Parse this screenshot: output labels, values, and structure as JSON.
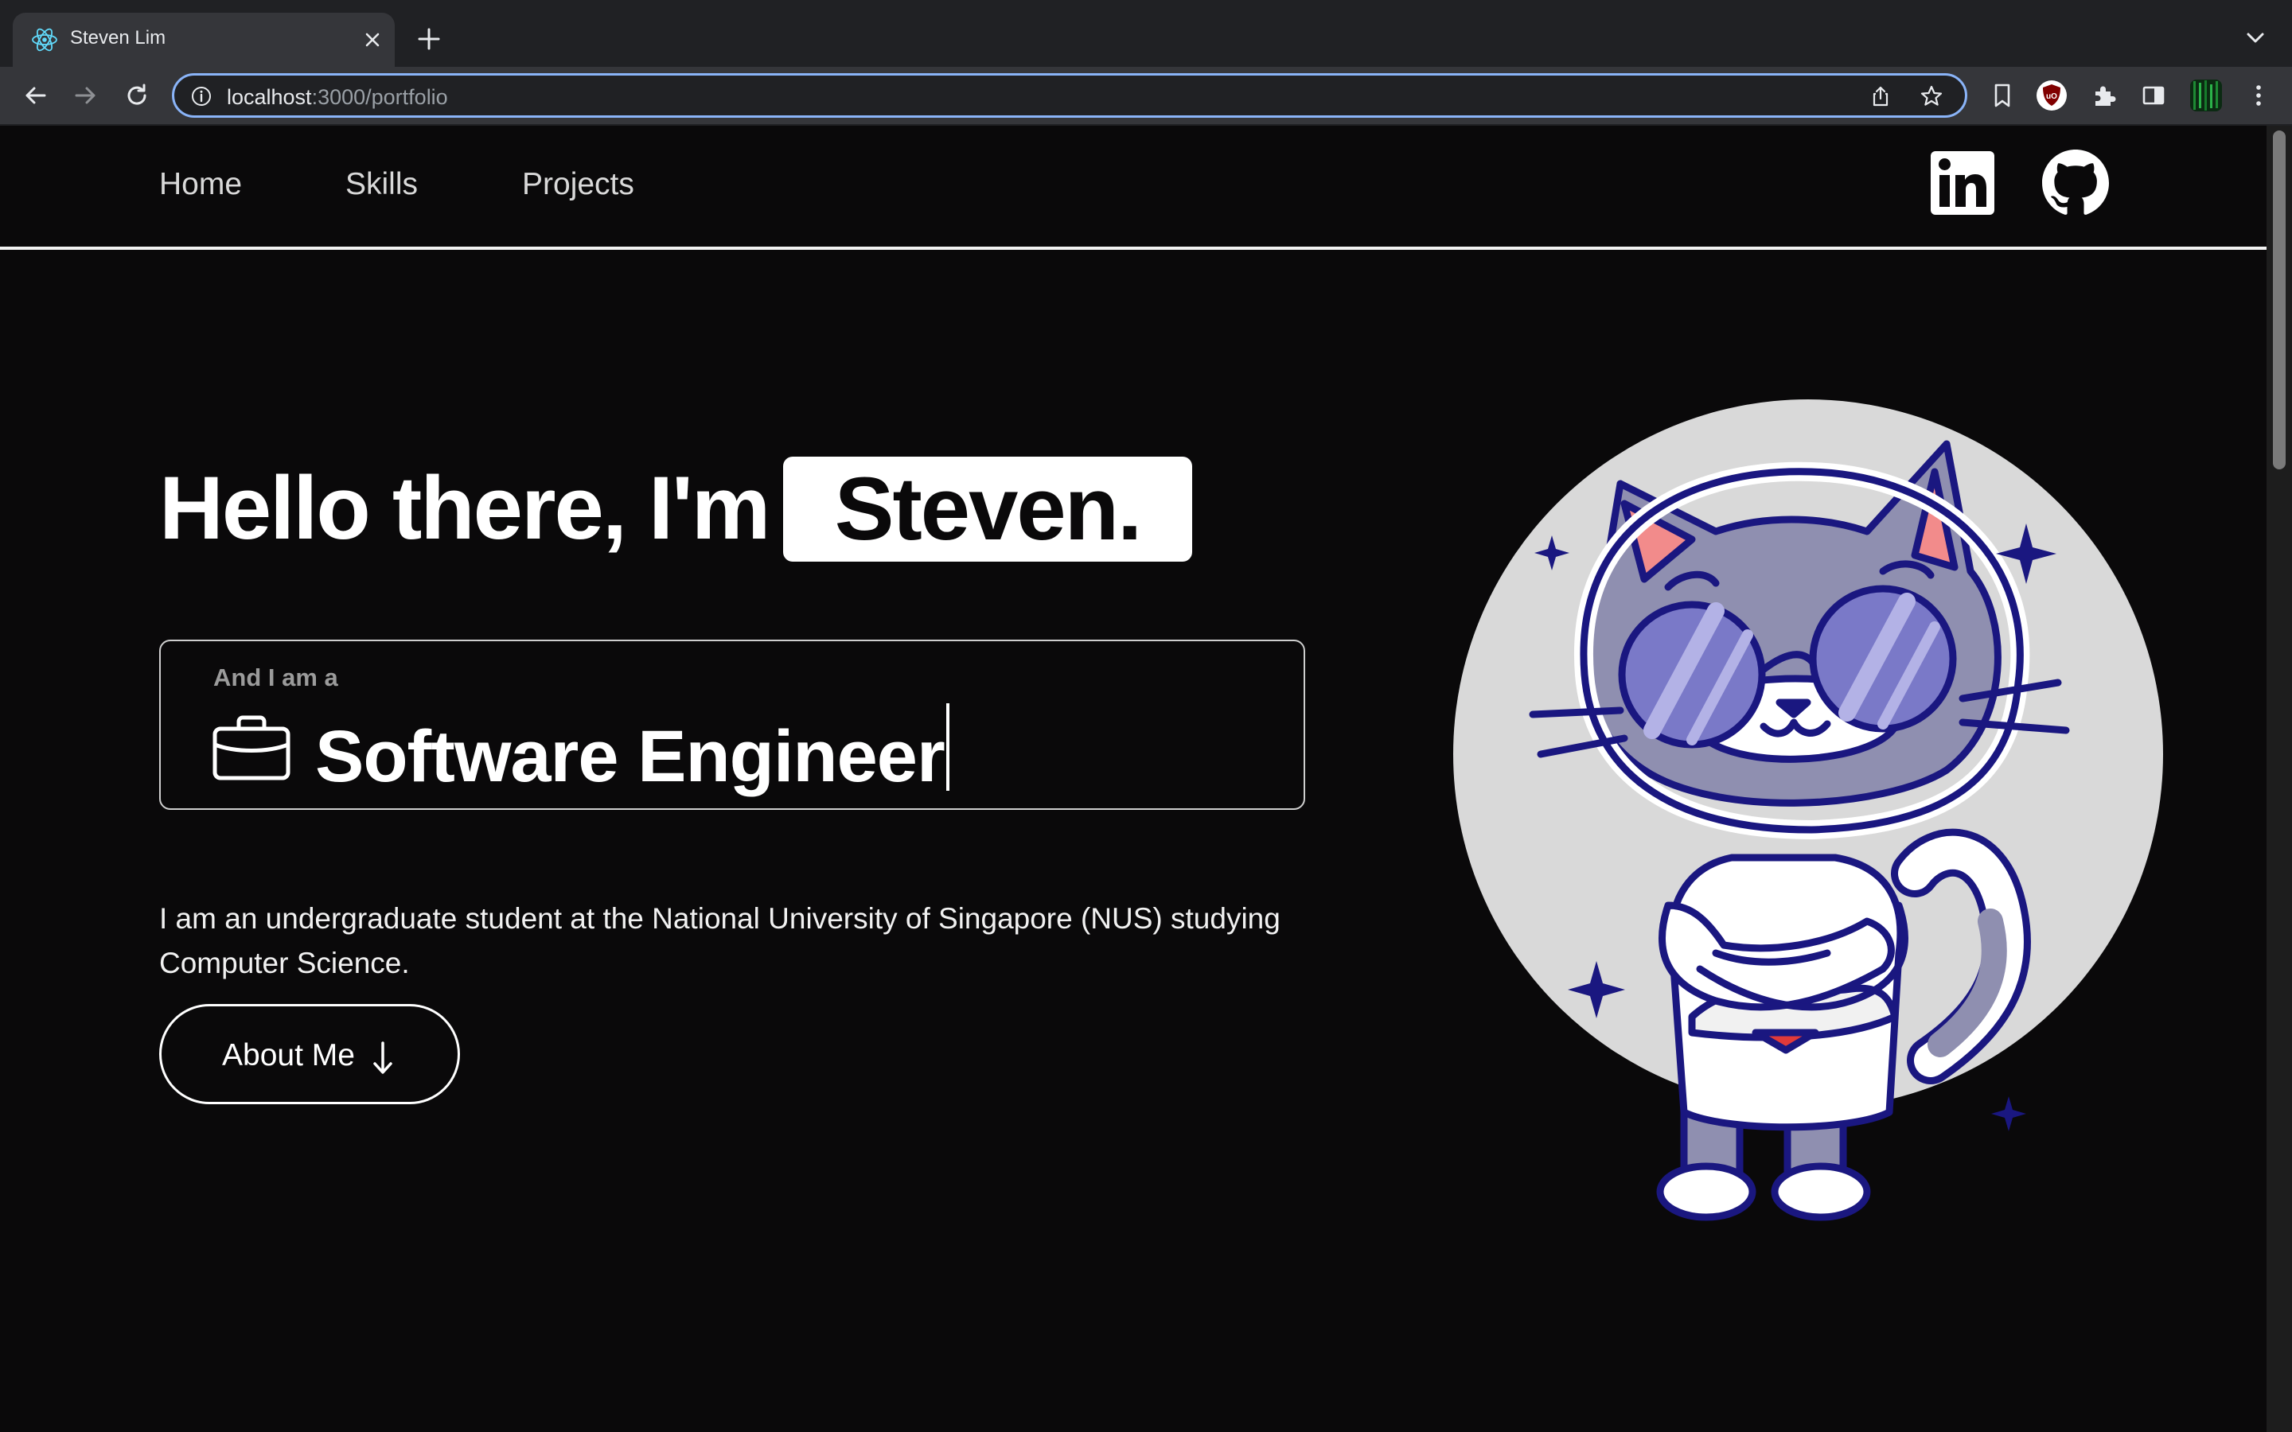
{
  "browser": {
    "tab_title": "Steven Lim",
    "url_host": "localhost",
    "url_rest": ":3000/portfolio"
  },
  "nav": {
    "links": [
      "Home",
      "Skills",
      "Projects"
    ],
    "social": [
      "linkedin-icon",
      "github-icon"
    ]
  },
  "hero": {
    "greeting": "Hello there, I'm",
    "name": "Steven.",
    "role_label": "And I am a",
    "role": "Software Engineer",
    "bio": "I am an undergraduate student at the National University of Singapore (NUS) studying Computer Science.",
    "cta_label": "About Me"
  },
  "icons": {
    "favicon": "react-icon",
    "role_icon": "briefcase-icon",
    "cta_icon": "arrow-down-icon",
    "avatar": "cool-cat-illustration"
  },
  "colors": {
    "page_background": "#0a090a",
    "text": "#ffffff",
    "accent_omnibox": "#8ab4f8",
    "avatar_circle": "#d9d9d9",
    "cat_outline": "#1a1780"
  }
}
